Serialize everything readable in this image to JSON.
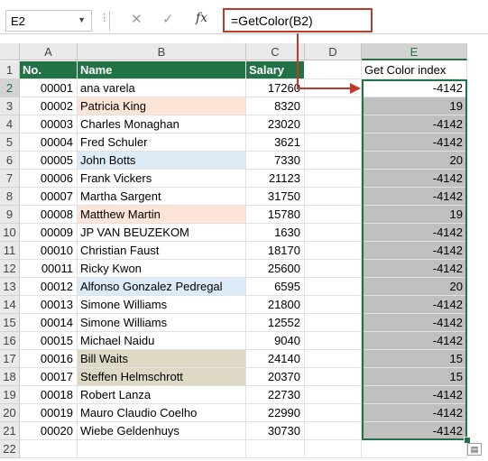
{
  "formula_bar": {
    "name_box": "E2",
    "formula": "=GetColor(B2)",
    "icons": [
      "more-options-icon",
      "cancel-icon",
      "enter-icon",
      "insert-function-icon"
    ]
  },
  "columns": [
    "A",
    "B",
    "C",
    "D",
    "E"
  ],
  "rows": [
    "1",
    "2",
    "3",
    "4",
    "5",
    "6",
    "7",
    "8",
    "9",
    "10",
    "11",
    "12",
    "13",
    "14",
    "15",
    "16",
    "17",
    "18",
    "19",
    "20",
    "21",
    "22"
  ],
  "header": {
    "no": "No.",
    "name": "Name",
    "salary": "Salary",
    "e_label": "Get Color index"
  },
  "colors": {
    "header_green": "#217346",
    "orange_fill": "#fce4d6",
    "blue_fill": "#ddebf7",
    "tan_fill": "#ddd9c4",
    "selection_gray": "#c0c0c0",
    "annotation_red": "#c0392b"
  },
  "records": [
    {
      "no": "00001",
      "name": "ana varela",
      "salary": "17260",
      "color": "-4142",
      "fill": "none"
    },
    {
      "no": "00002",
      "name": "Patricia King",
      "salary": "8320",
      "color": "19",
      "fill": "orange"
    },
    {
      "no": "00003",
      "name": "Charles Monaghan",
      "salary": "23020",
      "color": "-4142",
      "fill": "none"
    },
    {
      "no": "00004",
      "name": "Fred Schuler",
      "salary": "3621",
      "color": "-4142",
      "fill": "none"
    },
    {
      "no": "00005",
      "name": "John Botts",
      "salary": "7330",
      "color": "20",
      "fill": "blue"
    },
    {
      "no": "00006",
      "name": "Frank Vickers",
      "salary": "21123",
      "color": "-4142",
      "fill": "none"
    },
    {
      "no": "00007",
      "name": "Martha Sargent",
      "salary": "31750",
      "color": "-4142",
      "fill": "none"
    },
    {
      "no": "00008",
      "name": "Matthew Martin",
      "salary": "15780",
      "color": "19",
      "fill": "orange"
    },
    {
      "no": "00009",
      "name": "JP VAN BEUZEKOM",
      "salary": "1630",
      "color": "-4142",
      "fill": "none"
    },
    {
      "no": "00010",
      "name": "Christian Faust",
      "salary": "18170",
      "color": "-4142",
      "fill": "none"
    },
    {
      "no": "00011",
      "name": "Ricky Kwon",
      "salary": "25600",
      "color": "-4142",
      "fill": "none"
    },
    {
      "no": "00012",
      "name": "Alfonso Gonzalez Pedregal",
      "salary": "6595",
      "color": "20",
      "fill": "blue"
    },
    {
      "no": "00013",
      "name": "Simone Williams",
      "salary": "21800",
      "color": "-4142",
      "fill": "none"
    },
    {
      "no": "00014",
      "name": "Simone Williams",
      "salary": "12552",
      "color": "-4142",
      "fill": "none"
    },
    {
      "no": "00015",
      "name": "Michael Naidu",
      "salary": "9040",
      "color": "-4142",
      "fill": "none"
    },
    {
      "no": "00016",
      "name": "Bill Waits",
      "salary": "24140",
      "color": "15",
      "fill": "tan"
    },
    {
      "no": "00017",
      "name": "Steffen Helmschrott",
      "salary": "20370",
      "color": "15",
      "fill": "tan"
    },
    {
      "no": "00018",
      "name": "Robert Lanza",
      "salary": "22730",
      "color": "-4142",
      "fill": "none"
    },
    {
      "no": "00019",
      "name": "Mauro Claudio Coelho",
      "salary": "22990",
      "color": "-4142",
      "fill": "none"
    },
    {
      "no": "00020",
      "name": "Wiebe Geldenhuys",
      "salary": "30730",
      "color": "-4142",
      "fill": "none"
    }
  ]
}
